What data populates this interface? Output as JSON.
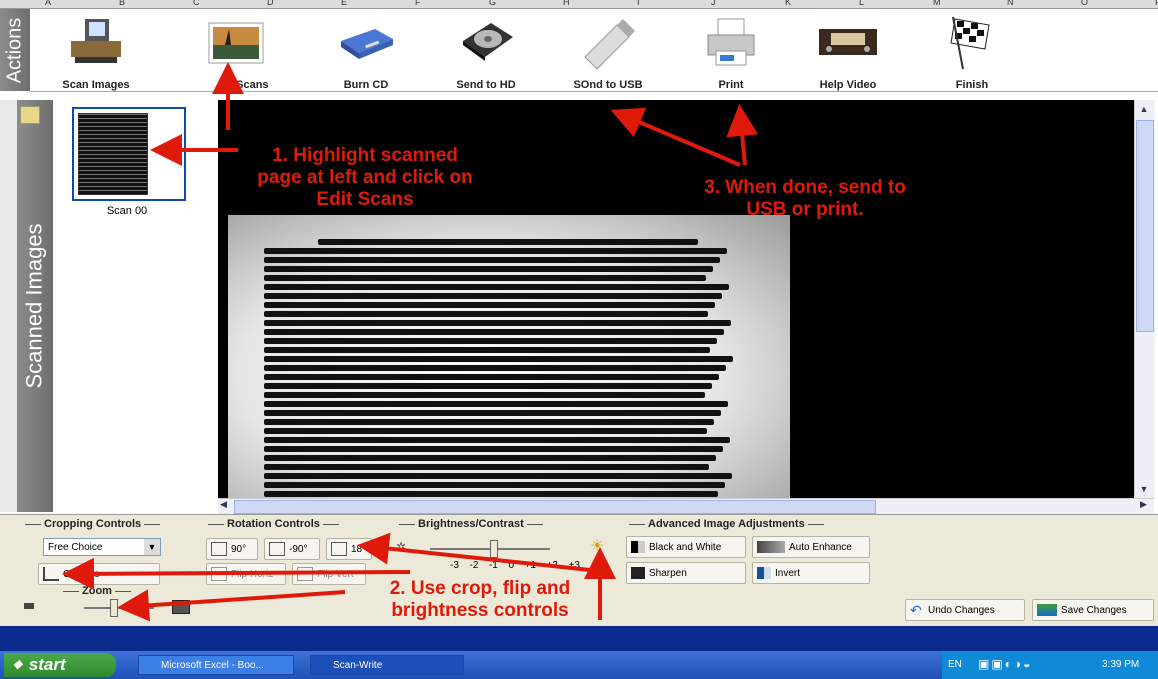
{
  "spreadsheet_columns": [
    "A",
    "B",
    "C",
    "D",
    "E",
    "F",
    "G",
    "H",
    "I",
    "J",
    "K",
    "L",
    "M",
    "N",
    "O",
    "P"
  ],
  "tabs": {
    "actions": "Actions",
    "scanned_images": "Scanned Images"
  },
  "toolbar": [
    {
      "label": "Scan Images",
      "icon": "scanner-icon"
    },
    {
      "label": "Edit Scans",
      "icon": "photo-icon"
    },
    {
      "label": "Burn CD",
      "icon": "cd-drive-icon"
    },
    {
      "label": "Send to HD",
      "icon": "hard-drive-icon"
    },
    {
      "label": "Send to USB",
      "icon": "usb-drive-icon"
    },
    {
      "label": "Print",
      "icon": "printer-icon"
    },
    {
      "label": "Help Video",
      "icon": "videotape-icon"
    },
    {
      "label": "Finish",
      "icon": "checkered-flag-icon"
    }
  ],
  "toolbar_visible_labels": [
    "Scan Images",
    "t Scans",
    "Burn CD",
    "Send to HD",
    "SOnd to USB",
    "Print",
    "Help Video",
    "Finish"
  ],
  "thumbnail": {
    "label": "Scan 00"
  },
  "controls": {
    "cropping": {
      "title": "Cropping Controls",
      "select_value": "Free Choice",
      "crop_button": "Crop Selection",
      "crop_visible": "Crop Se"
    },
    "zoom": {
      "title": "Zoom",
      "level": 0.4
    },
    "rotation": {
      "title": "Rotation Controls",
      "rot_cw": "90°",
      "rot_ccw": "-90°",
      "third": "18",
      "flip_h": "Flip Horiz",
      "flip_v": "Flip Vert"
    },
    "brightness": {
      "title": "Brightness/Contrast",
      "scale": [
        "-3",
        "-2",
        "-1",
        "0",
        "+1",
        "+2",
        "+3"
      ],
      "level": 0.5
    },
    "advanced": {
      "title": "Advanced Image Adjustments",
      "bw": "Black and White",
      "auto": "Auto Enhance",
      "sharpen": "Sharpen",
      "invert": "Invert"
    },
    "undo": "Undo Changes",
    "save": "Save Changes"
  },
  "annotations": {
    "note1": "1. Highlight scanned\npage at left and click on\nEdit Scans",
    "note2": "2. Use crop, flip and\nbrightness controls",
    "note3": "3. When done, send to\nUSB or print."
  },
  "taskbar": {
    "start": "start",
    "tasks": [
      "Microsoft Excel - Boo...",
      "Scan-Write"
    ],
    "lang": "EN",
    "time": "3:39 PM"
  },
  "colors": {
    "annotation": "#e01a0a",
    "selection": "#0a4ab5",
    "taskbar": "#2459c8"
  }
}
